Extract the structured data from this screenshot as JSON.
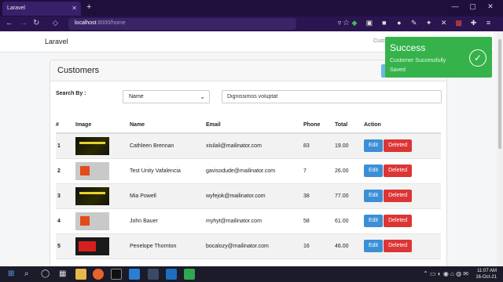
{
  "browser": {
    "tab_title": "Laravel",
    "tab_close": "✕",
    "new_tab": "+",
    "url_host": "localhost",
    "url_path": ":8000/home",
    "window_controls": [
      "—",
      "▢",
      "✕"
    ]
  },
  "app": {
    "brand": "Laravel",
    "header_link": "Cust"
  },
  "card": {
    "title": "Customers",
    "search_label": "Search By :",
    "select_value": "Name",
    "search_value": "Dignissimos voluptat"
  },
  "table": {
    "headers": [
      "#",
      "Image",
      "Name",
      "Email",
      "Phone",
      "Total",
      "Action"
    ],
    "rows": [
      {
        "num": "1",
        "name": "Cathleen Brennan",
        "email": "xisilali@mailinator.com",
        "phone": "83",
        "total": "19.00",
        "edit": "Edit",
        "delete": "Deleted"
      },
      {
        "num": "2",
        "name": "Test Unity Vafalencia",
        "email": "gavisodude@mailinator.com",
        "phone": "7",
        "total": "26.00",
        "edit": "Edit",
        "delete": "Deleted"
      },
      {
        "num": "3",
        "name": "Mia Powell",
        "email": "wyfejok@mailinator.com",
        "phone": "38",
        "total": "77.00",
        "edit": "Edit",
        "delete": "Deleted"
      },
      {
        "num": "4",
        "name": "John Bauer",
        "email": "myhyt@mailinator.com",
        "phone": "58",
        "total": "61.00",
        "edit": "Edit",
        "delete": "Deleted"
      },
      {
        "num": "5",
        "name": "Penelope Thornton",
        "email": "bocalozy@mailinator.com",
        "phone": "16",
        "total": "46.00",
        "edit": "Edit",
        "delete": "Deleted"
      }
    ]
  },
  "toast": {
    "title": "Success",
    "message": "Customer Successfully Saved",
    "color": "#35b34a"
  },
  "taskbar": {
    "time": "11:07 AM",
    "date": "16-Oct-21"
  }
}
